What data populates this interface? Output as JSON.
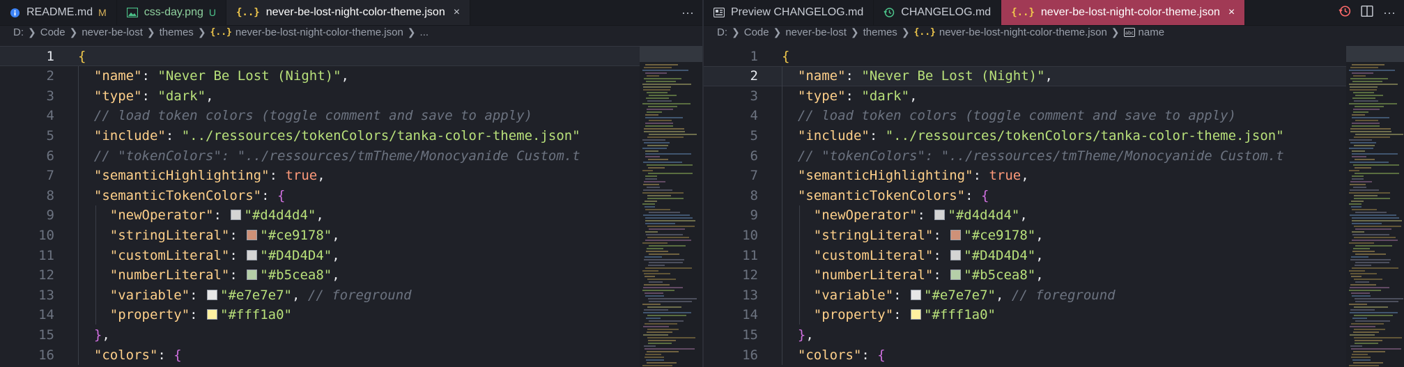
{
  "left_pane": {
    "tabs": [
      {
        "label": "README.md",
        "status": "M",
        "icon": "info-icon"
      },
      {
        "label": "css-day.png",
        "status": "U",
        "icon": "image-icon"
      },
      {
        "label": "never-be-lost-night-color-theme.json",
        "close": "×",
        "icon": "json-icon"
      }
    ],
    "more_label": "···",
    "breadcrumb": [
      "D:",
      "Code",
      "never-be-lost",
      "themes",
      "never-be-lost-night-color-theme.json",
      "..."
    ],
    "current_line": 1
  },
  "right_pane": {
    "tabs": [
      {
        "label": "Preview CHANGELOG.md",
        "icon": "preview-icon"
      },
      {
        "label": "CHANGELOG.md",
        "icon": "history-icon"
      },
      {
        "label": "never-be-lost-night-color-theme.json",
        "close": "×",
        "icon": "json-icon"
      }
    ],
    "breadcrumb": [
      "D:",
      "Code",
      "never-be-lost",
      "themes",
      "never-be-lost-night-color-theme.json",
      "name"
    ],
    "current_line": 2
  },
  "line_numbers": [
    "1",
    "2",
    "3",
    "4",
    "5",
    "6",
    "7",
    "8",
    "9",
    "10",
    "11",
    "12",
    "13",
    "14",
    "15",
    "16"
  ],
  "code": {
    "l2_key": "\"name\"",
    "l2_val": "\"Never Be Lost (Night)\"",
    "l3_key": "\"type\"",
    "l3_val": "\"dark\"",
    "l4_comment": "// load token colors (toggle comment and save to apply)",
    "l5_key": "\"include\"",
    "l5_val": "\"../ressources/tokenColors/tanka-color-theme.json\"",
    "l6_comment": "// \"tokenColors\": \"../ressources/tmTheme/Monocyanide Custom.t",
    "l7_key": "\"semanticHighlighting\"",
    "l7_val": "true",
    "l8_key": "\"semanticTokenColors\"",
    "tokens": [
      {
        "key": "\"newOperator\"",
        "val": "\"#d4d4d4\"",
        "swatch": "#d4d4d4"
      },
      {
        "key": "\"stringLiteral\"",
        "val": "\"#ce9178\"",
        "swatch": "#ce9178"
      },
      {
        "key": "\"customLiteral\"",
        "val": "\"#D4D4D4\"",
        "swatch": "#D4D4D4"
      },
      {
        "key": "\"numberLiteral\"",
        "val": "\"#b5cea8\"",
        "swatch": "#b5cea8"
      },
      {
        "key": "\"variable\"",
        "val": "\"#e7e7e7\"",
        "swatch": "#e7e7e7",
        "comment": "// foreground"
      },
      {
        "key": "\"property\"",
        "val": "\"#fff1a0\"",
        "swatch": "#fff1a0"
      }
    ],
    "l16_key": "\"colors\""
  },
  "colors": {
    "accent_tab": "#a13a55",
    "key": "#ffd08a",
    "string": "#b8e07a",
    "comment": "#6c7380"
  }
}
